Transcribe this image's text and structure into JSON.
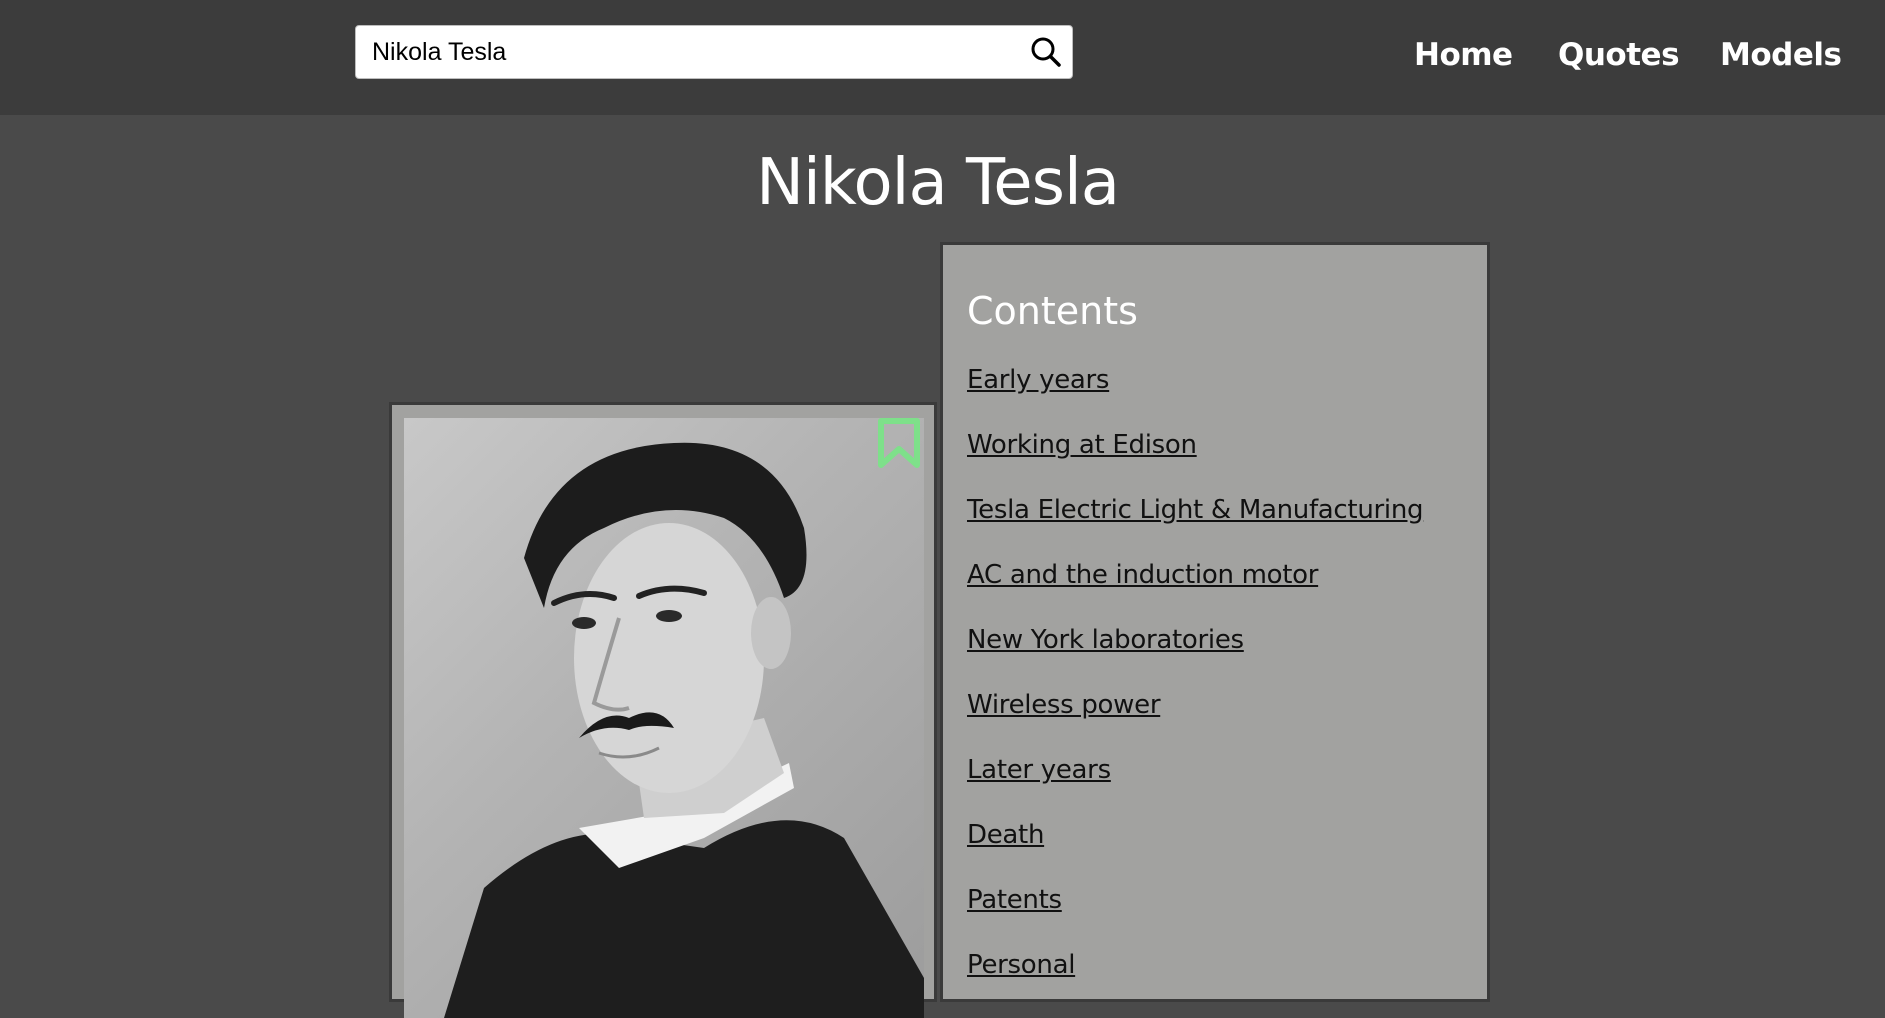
{
  "search": {
    "value": "Nikola Tesla"
  },
  "nav": {
    "home": "Home",
    "quotes": "Quotes",
    "models": "Models"
  },
  "page": {
    "title": "Nikola Tesla"
  },
  "contents": {
    "heading": "Contents",
    "items": [
      "Early years",
      "Working at Edison",
      "Tesla Electric Light & Manufacturing",
      "AC and the induction motor",
      "New York laboratories",
      "Wireless power",
      "Later years",
      "Death",
      "Patents",
      "Personal"
    ]
  },
  "colors": {
    "bookmark": "#7ee08a",
    "panel": "#a2a2a0",
    "header": "#3c3c3c",
    "background": "#4a4a4a"
  },
  "icons": {
    "search": "search-icon",
    "bookmark": "bookmark-icon"
  }
}
